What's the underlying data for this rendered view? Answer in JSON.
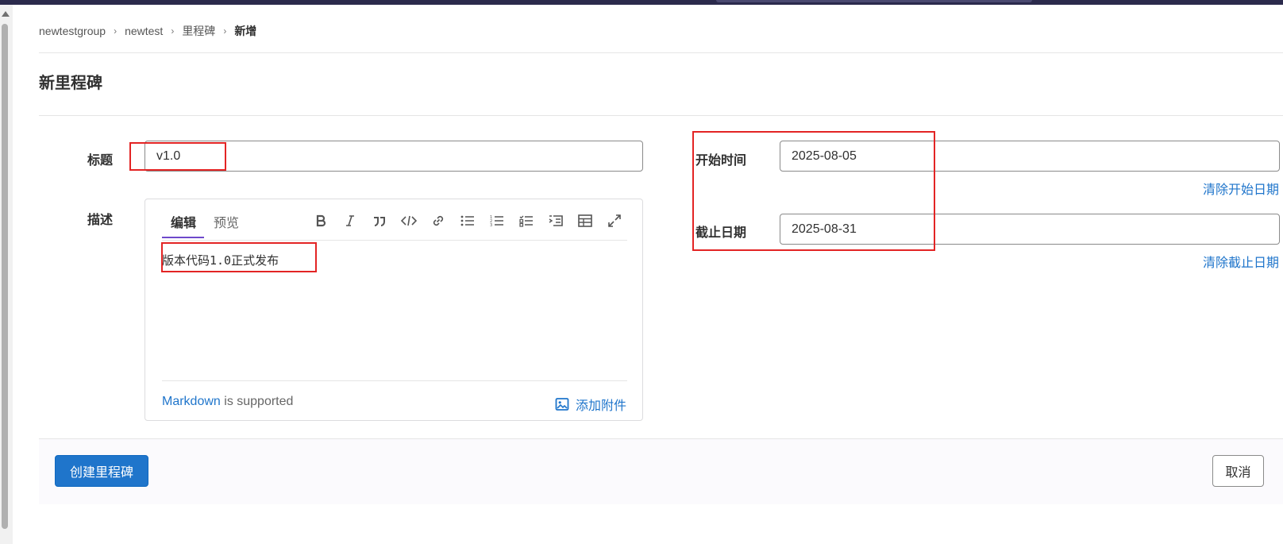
{
  "breadcrumb": {
    "items": [
      "newtestgroup",
      "newtest",
      "里程碑"
    ],
    "current": "新增"
  },
  "page": {
    "title": "新里程碑"
  },
  "form": {
    "title_label": "标题",
    "title_value": "v1.0",
    "description_label": "描述",
    "editor": {
      "tabs": [
        "编辑",
        "预览"
      ],
      "content": "版本代码1.0正式发布",
      "markdown_link": "Markdown",
      "markdown_suffix": " is supported",
      "attach_label": "添加附件",
      "toolbar_icons": [
        "bold-icon",
        "italic-icon",
        "quote-icon",
        "code-icon",
        "link-icon",
        "bullet-list-icon",
        "numbered-list-icon",
        "task-list-icon",
        "indent-icon",
        "table-icon",
        "fullscreen-icon"
      ]
    },
    "start_label": "开始时间",
    "start_value": "2025-08-05",
    "clear_start": "清除开始日期",
    "due_label": "截止日期",
    "due_value": "2025-08-31",
    "clear_due": "清除截止日期"
  },
  "actions": {
    "create": "创建里程碑",
    "cancel": "取消"
  },
  "colors": {
    "link": "#1f75cb",
    "primary": "#1f75cb",
    "annotation": "#e32424",
    "topbar": "#2b2a4c"
  }
}
